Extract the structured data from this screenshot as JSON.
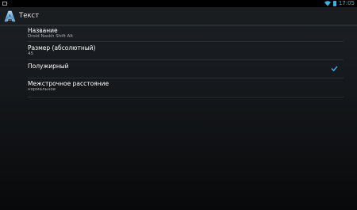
{
  "status_bar": {
    "time": "17:05",
    "notification_icon": "screenshot-icon",
    "wifi_icon": "wifi-icon",
    "battery_icon": "battery-icon",
    "accent_color": "#33b5e5"
  },
  "action_bar": {
    "app_icon": "app-logo-icon",
    "title": "Текст"
  },
  "settings": [
    {
      "label": "Название",
      "sub": "Droid Naskh Shift Alt"
    },
    {
      "label": "Размер (абсолютный)",
      "sub": "45"
    },
    {
      "label": "Полужирный",
      "checked": true,
      "check_icon": "checkmark-icon"
    },
    {
      "label": "Межстрочное расстояние",
      "sub": "нормальное"
    }
  ]
}
